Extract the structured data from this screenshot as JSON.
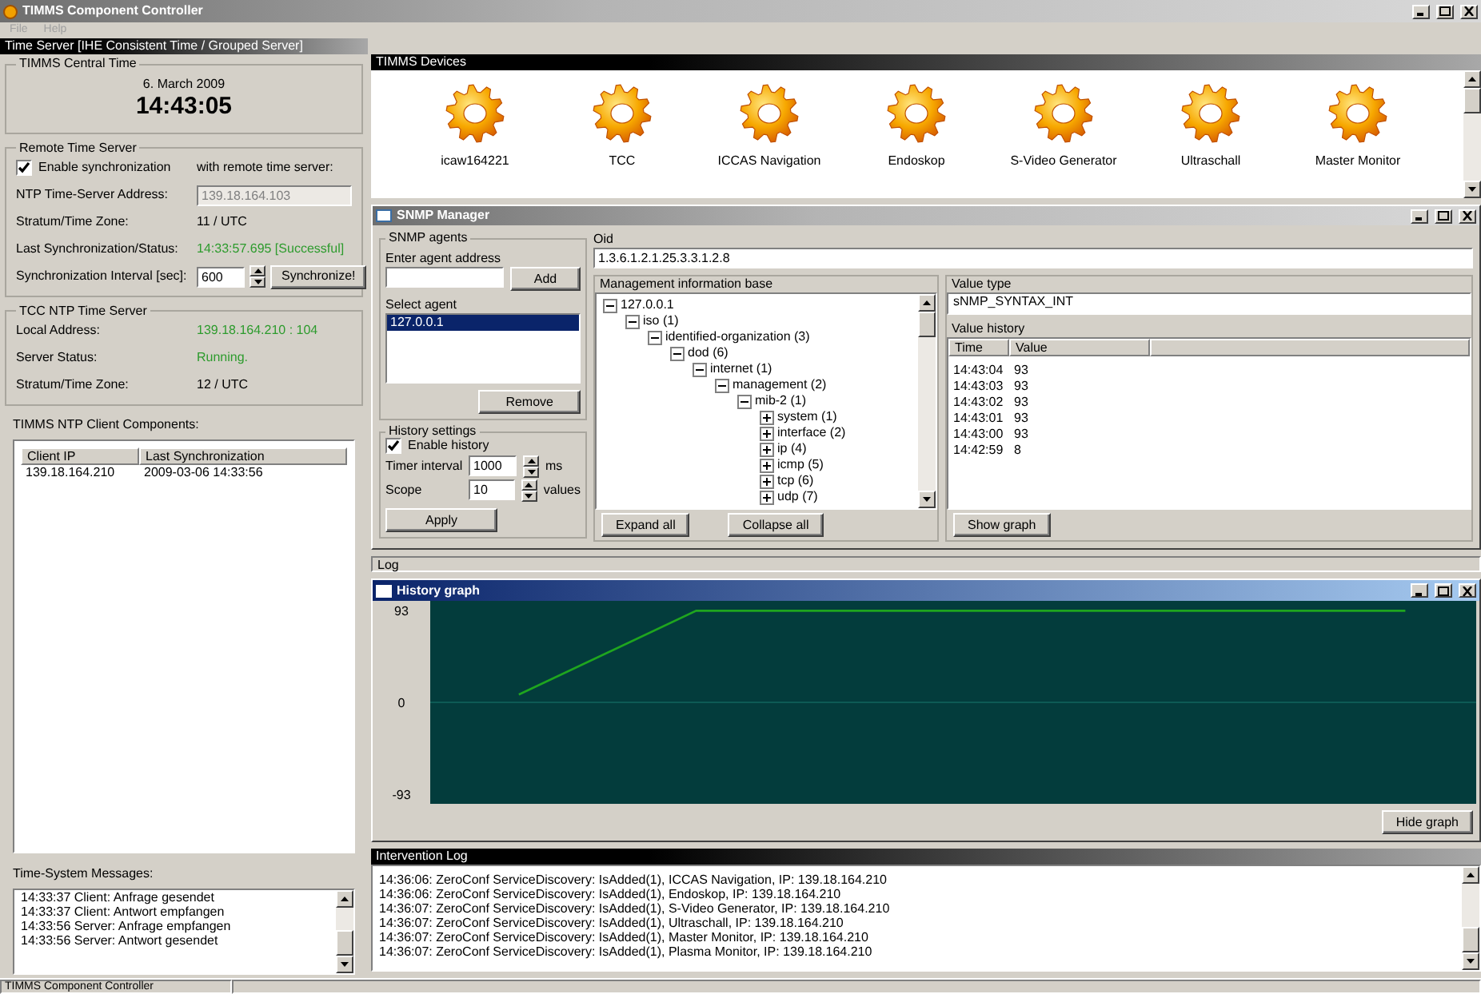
{
  "window": {
    "title": "TIMMS Component Controller"
  },
  "menu": [
    {
      "label": "File",
      "disabled": true
    },
    {
      "label": "Help",
      "disabled": true
    }
  ],
  "time_server": {
    "header": "Time Server  [IHE Consistent Time / Grouped Server]",
    "central_time": {
      "legend": "TIMMS Central Time",
      "date": "6. March 2009",
      "time": "14:43:05"
    },
    "remote": {
      "legend": "Remote Time Server",
      "enable_label": "Enable synchronization",
      "enable_checked": true,
      "with_label": "with remote time server:",
      "rows": [
        {
          "kind": "field",
          "label": "NTP Time-Server Address:",
          "value": "139.18.164.103",
          "disabled": true
        },
        {
          "kind": "text",
          "label": "Stratum/Time Zone:",
          "value": "11 / UTC"
        },
        {
          "kind": "ok",
          "label": "Last Synchronization/Status:",
          "value": "14:33:57.695 [Successful]"
        },
        {
          "kind": "spin",
          "label": "Synchronization Interval [sec]:",
          "value": "600",
          "button": "Synchronize!"
        }
      ]
    },
    "tcc": {
      "legend": "TCC NTP Time Server",
      "rows": [
        {
          "kind": "ok",
          "label": "Local Address:",
          "value": "139.18.164.210 : 104"
        },
        {
          "kind": "ok",
          "label": "Server Status:",
          "value": "Running."
        },
        {
          "kind": "text",
          "label": "Stratum/Time Zone:",
          "value": "12 / UTC"
        }
      ]
    },
    "clients": {
      "label": "TIMMS NTP Client Components:",
      "columns": [
        "Client IP",
        "Last Synchronization"
      ],
      "rows": [
        [
          "139.18.164.210",
          "2009-03-06 14:33:56"
        ]
      ]
    },
    "messages": {
      "label": "Time-System Messages:",
      "lines": [
        "14:33:37 Client:  Anfrage gesendet",
        "14:33:37 Client:  Antwort empfangen",
        "14:33:56 Server:  Anfrage empfangen",
        "14:33:56 Server:  Antwort gesendet"
      ]
    }
  },
  "devices": {
    "header": "TIMMS Devices",
    "items": [
      "icaw164221",
      "TCC",
      "ICCAS Navigation",
      "Endoskop",
      "S-Video Generator",
      "Ultraschall",
      "Master Monitor"
    ]
  },
  "snmp": {
    "title": "SNMP Manager",
    "agents_legend": "SNMP agents",
    "enter_label": "Enter agent address",
    "add": "Add",
    "select_label": "Select agent",
    "agents": [
      {
        "label": "127.0.0.1",
        "selected": true
      }
    ],
    "remove": "Remove",
    "history": {
      "legend": "History settings",
      "enable_label": "Enable history",
      "enable_checked": true,
      "timer_label": "Timer interval",
      "timer_value": "1000",
      "timer_unit": "ms",
      "scope_label": "Scope",
      "scope_value": "10",
      "scope_unit": "values",
      "apply": "Apply"
    },
    "oid_label": "Oid",
    "oid": "1.3.6.1.2.1.25.3.3.1.2.8",
    "mib_label": "Management information base",
    "tree": [
      {
        "label": "127.0.0.1",
        "expanded": true,
        "children": [
          {
            "label": "iso (1)",
            "expanded": true,
            "children": [
              {
                "label": "identified-organization (3)",
                "expanded": true,
                "children": [
                  {
                    "label": "dod (6)",
                    "expanded": true,
                    "children": [
                      {
                        "label": "internet (1)",
                        "expanded": true,
                        "children": [
                          {
                            "label": "management (2)",
                            "expanded": true,
                            "children": [
                              {
                                "label": "mib-2 (1)",
                                "expanded": true,
                                "children": [
                                  {
                                    "label": "system (1)",
                                    "expanded": false
                                  },
                                  {
                                    "label": "interface (2)",
                                    "expanded": false
                                  },
                                  {
                                    "label": "ip (4)",
                                    "expanded": false
                                  },
                                  {
                                    "label": "icmp (5)",
                                    "expanded": false
                                  },
                                  {
                                    "label": "tcp (6)",
                                    "expanded": false
                                  },
                                  {
                                    "label": "udp (7)",
                                    "expanded": false
                                  }
                                ]
                              }
                            ]
                          }
                        ]
                      }
                    ]
                  }
                ]
              }
            ]
          }
        ]
      }
    ],
    "expand_all": "Expand all",
    "collapse_all": "Collapse all",
    "value_type_label": "Value type",
    "value_type": "sNMP_SYNTAX_INT",
    "history_label": "Value history",
    "history_columns": [
      "Time",
      "Value"
    ],
    "history_rows": [
      {
        "time": "14:43:04",
        "value": "93"
      },
      {
        "time": "14:43:03",
        "value": "93"
      },
      {
        "time": "14:43:02",
        "value": "93"
      },
      {
        "time": "14:43:01",
        "value": "93"
      },
      {
        "time": "14:43:00",
        "value": "93"
      },
      {
        "time": "14:42:59",
        "value": "8"
      }
    ],
    "show_graph": "Show graph"
  },
  "log_label": "Log",
  "graph": {
    "title": "History graph",
    "hide": "Hide graph",
    "chart_data": {
      "type": "line",
      "categories": [
        null,
        null,
        null,
        null,
        null,
        null
      ],
      "ylim": [
        -103,
        103
      ],
      "yticks": [
        93,
        0,
        -93
      ],
      "series": [
        {
          "color": "#1fa51f",
          "values": [
            8,
            93,
            93,
            93,
            93,
            93
          ]
        }
      ]
    }
  },
  "intervention": {
    "header": "Intervention Log",
    "lines": [
      "14:36:06: ZeroConf ServiceDiscovery: IsAdded(1), ICCAS Navigation, IP: 139.18.164.210",
      "14:36:06: ZeroConf ServiceDiscovery: IsAdded(1), Endoskop, IP: 139.18.164.210",
      "14:36:07: ZeroConf ServiceDiscovery: IsAdded(1), S-Video Generator, IP: 139.18.164.210",
      "14:36:07: ZeroConf ServiceDiscovery: IsAdded(1), Ultraschall, IP: 139.18.164.210",
      "14:36:07: ZeroConf ServiceDiscovery: IsAdded(1), Master Monitor, IP: 139.18.164.210",
      "14:36:07: ZeroConf ServiceDiscovery: IsAdded(1), Plasma Monitor, IP: 139.18.164.210"
    ]
  },
  "status_bar": "TIMMS Component Controller"
}
